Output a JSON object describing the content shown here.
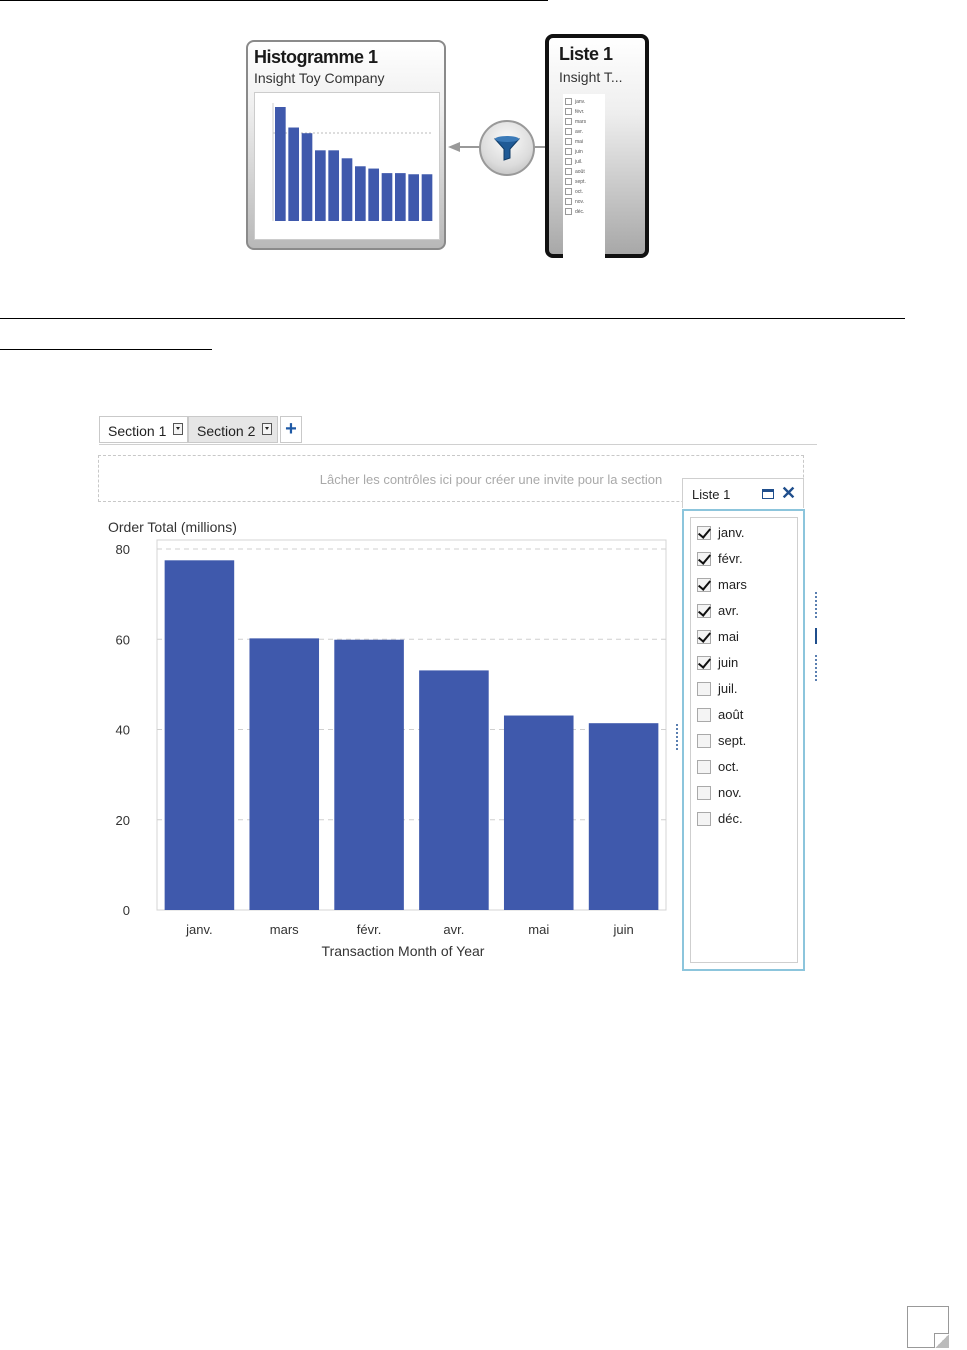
{
  "diagram": {
    "histogram_node": {
      "title": "Histogramme 1",
      "subtitle": "Insight Toy Company",
      "thumbnail_values": [
        100,
        82,
        77,
        62,
        62,
        55,
        48,
        46,
        42,
        42,
        41,
        41
      ]
    },
    "list_node": {
      "title": "Liste 1",
      "subtitle": "Insight T...",
      "thumbnail_items": [
        "janv.",
        "févr.",
        "mars",
        "avr.",
        "mai",
        "juin",
        "juil.",
        "août",
        "sept.",
        "oct.",
        "nov.",
        "déc."
      ]
    },
    "filter_icon": "funnel-icon"
  },
  "tabs": [
    {
      "label": "Section 1"
    },
    {
      "label": "Section 2"
    }
  ],
  "add_tab_icon": "plus-icon",
  "dropzone_text": "Lâcher les contrôles ici pour créer une invite pour la section",
  "list_panel": {
    "title": "Liste 1",
    "items": [
      {
        "label": "janv.",
        "checked": true
      },
      {
        "label": "févr.",
        "checked": true
      },
      {
        "label": "mars",
        "checked": true
      },
      {
        "label": "avr.",
        "checked": true
      },
      {
        "label": "mai",
        "checked": true
      },
      {
        "label": "juin",
        "checked": true
      },
      {
        "label": "juil.",
        "checked": false
      },
      {
        "label": "août",
        "checked": false
      },
      {
        "label": "sept.",
        "checked": false
      },
      {
        "label": "oct.",
        "checked": false
      },
      {
        "label": "nov.",
        "checked": false
      },
      {
        "label": "déc.",
        "checked": false
      }
    ]
  },
  "chart_data": {
    "type": "bar",
    "categories": [
      "janv.",
      "mars",
      "févr.",
      "avr.",
      "mai",
      "juin"
    ],
    "values": [
      77.5,
      60.2,
      59.9,
      53.1,
      43.1,
      41.4
    ],
    "title": "",
    "xlabel": "Transaction Month of Year",
    "ylabel": "Order Total (millions)",
    "ylim": [
      0,
      82
    ],
    "yticks": [
      0,
      20,
      40,
      60,
      80
    ],
    "grid": true,
    "bar_color": "#3f59ac"
  }
}
